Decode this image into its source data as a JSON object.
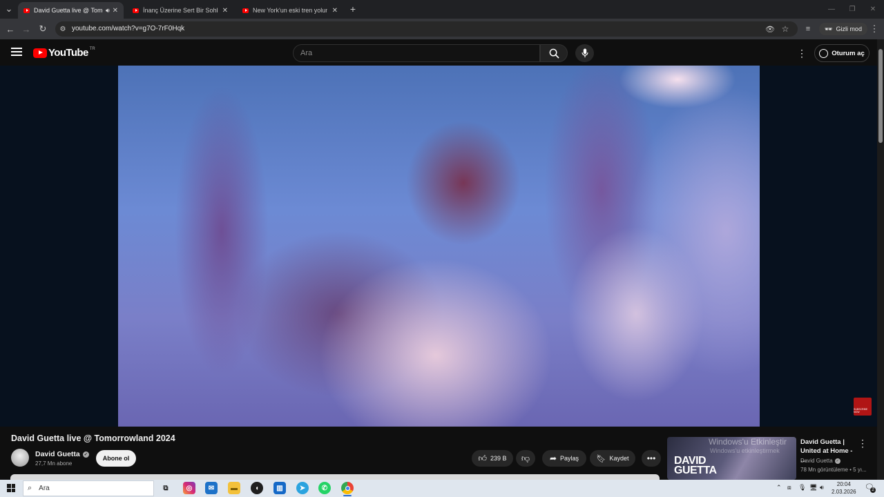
{
  "browser": {
    "tabs": [
      {
        "title": "David Guetta live @ Tomorr",
        "active": true,
        "audio": true
      },
      {
        "title": "İnanç Üzerine Sert Bir Sohbet -",
        "active": false
      },
      {
        "title": "New York'un eski tren yolunda",
        "active": false
      }
    ],
    "url": "youtube.com/watch?v=g7O-7rF0Hqk",
    "incognito_label": "Gizli mod"
  },
  "youtube": {
    "logo_text": "YouTube",
    "country_code": "TR",
    "search_placeholder": "Ara",
    "signin_label": "Oturum aç"
  },
  "video": {
    "title": "David Guetta live @ Tomorrowland 2024",
    "channel": "David Guetta",
    "subscribers": "27,7 Mn abone",
    "subscribe_label": "Abone ol",
    "likes": "239 B",
    "share_label": "Paylaş",
    "save_label": "Kaydet",
    "watermark_text": "SUBSCRIBE NOW"
  },
  "recommended": [
    {
      "title": "David Guetta | United at Home - ...",
      "channel": "David Guetta",
      "views": "78 Mn görüntüleme • 5 yı...",
      "thumb_text": "DAVID GUETTA",
      "overlay_line1": "Windows'u Etkinleştir",
      "overlay_line2": "Windows'u etkinleştirmek"
    }
  ],
  "taskbar": {
    "search_placeholder": "Ara",
    "time": "20:04",
    "date": "2.03.2026",
    "notification_count": "2"
  },
  "colors": {
    "youtube_red": "#ff0000",
    "background": "#0f0f0f",
    "taskbar": "#dfe6ee"
  }
}
